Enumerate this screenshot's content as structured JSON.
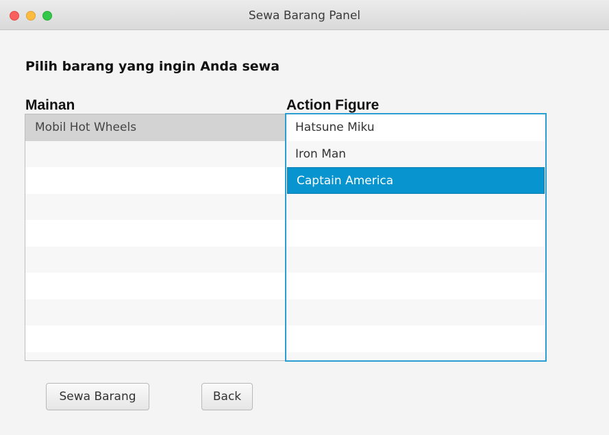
{
  "window": {
    "title": "Sewa Barang Panel"
  },
  "heading": "Pilih barang yang ingin Anda sewa",
  "mainan": {
    "label": "Mainan",
    "items": [
      "Mobil Hot Wheels"
    ],
    "selected_index": 0
  },
  "action_figure": {
    "label": "Action Figure",
    "items": [
      "Hatsune Miku",
      "Iron Man",
      "Captain America"
    ],
    "selected_index": 2
  },
  "buttons": {
    "sewa": "Sewa Barang",
    "back": "Back"
  },
  "colors": {
    "selection": "#0894cf",
    "focus_border": "#2a9ed3"
  }
}
